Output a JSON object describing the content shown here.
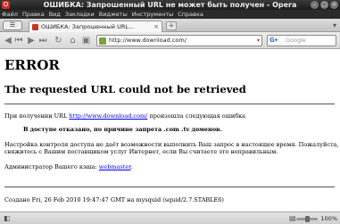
{
  "window": {
    "title": "ОШИБКА: Запрошенный URL не может быть получен - Opera"
  },
  "menu": [
    "Файл",
    "Правка",
    "Вид",
    "Закладки",
    "Виджеты",
    "Инструменты",
    "Справка"
  ],
  "tab": {
    "label": "ОШИБКА: Запрошенный URL..."
  },
  "address": {
    "url": "http://www.download.com/"
  },
  "search": {
    "placeholder": "Google"
  },
  "page": {
    "heading": "ERROR",
    "subheading": "The requested URL could not be retrieved",
    "intro_before": "При получении URL ",
    "intro_link": "http://www.download.com/",
    "intro_after": " произошла следующая ошибка",
    "denied": "В доступе отказано, по причине запрета .com .tv доменов.",
    "config_line1": "Настройка контроля доступа не даёт возможности выполнить Ваш запрос в настоящее время. Пожалуйста,",
    "config_line2": "свяжитесь с Вашим поставщиком услуг Интернет, если Вы считаете это неправильным.",
    "admin_before": "Администратор Вашего кэша: ",
    "admin_link": "webmaster",
    "admin_after": ".",
    "footer": "Создано Fri, 26 Feb 2010 19:47:47 GMT на mysquid (squid/2.7.STABLE6)"
  },
  "status": {
    "zoom": "100%"
  }
}
